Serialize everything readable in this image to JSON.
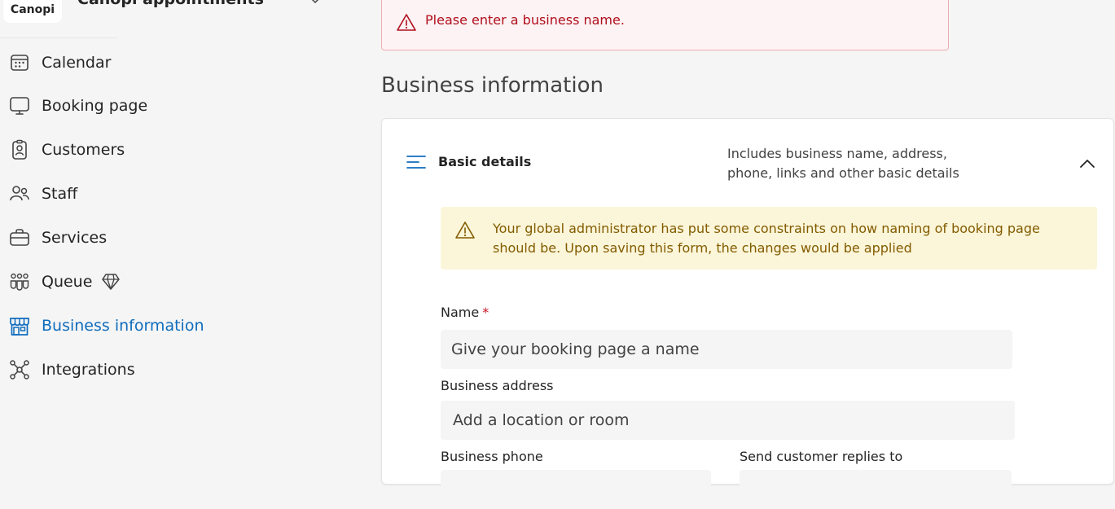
{
  "app": {
    "logo_text": "Canopi",
    "title": "Canopi appointments"
  },
  "nav": {
    "items": [
      {
        "label": "Calendar",
        "icon": "calendar-icon"
      },
      {
        "label": "Booking page",
        "icon": "monitor-icon"
      },
      {
        "label": "Customers",
        "icon": "contact-card-icon"
      },
      {
        "label": "Staff",
        "icon": "people-icon"
      },
      {
        "label": "Services",
        "icon": "briefcase-icon"
      },
      {
        "label": "Queue",
        "icon": "people-queue-icon",
        "badge_icon": "premium-diamond-icon"
      },
      {
        "label": "Business information",
        "icon": "storefront-icon",
        "active": true
      },
      {
        "label": "Integrations",
        "icon": "connections-icon"
      }
    ]
  },
  "error_banner": {
    "text": "Please enter a business name.",
    "icon": "warning-icon"
  },
  "section": {
    "title": "Business information"
  },
  "basic_details": {
    "title": "Basic details",
    "description": "Includes business name, address, phone, links and other basic details",
    "icon": "text-align-left-icon",
    "collapse_icon": "chevron-up-icon"
  },
  "warning_banner": {
    "text": "Your global administrator has put some constraints on how naming of booking page should be. Upon saving this form, the changes would be applied"
  },
  "form": {
    "name": {
      "label": "Name",
      "required_mark": "*",
      "placeholder": "Give your booking page a name"
    },
    "address": {
      "label": "Business address",
      "placeholder": "Add a location or room"
    },
    "phone": {
      "label": "Business phone"
    },
    "replies": {
      "label": "Send customer replies to"
    }
  },
  "colors": {
    "accent": "#0f6cbd",
    "error": "#b10e1c",
    "warning_text": "#835b00",
    "warning_bg": "#fbf6d9",
    "error_bg": "#fdf3f4"
  }
}
